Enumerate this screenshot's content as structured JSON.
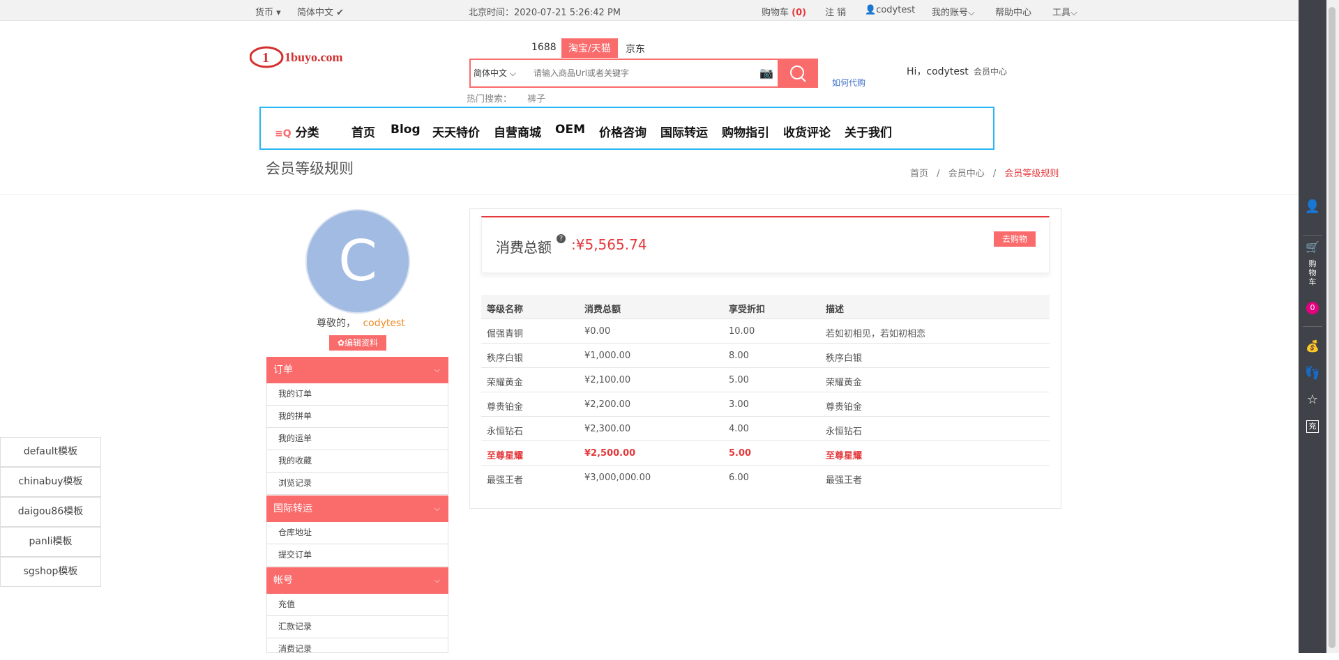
{
  "topbar": {
    "currency": "货币",
    "language": "简体中文",
    "time_label": "北京时间：",
    "time_value": "2020-07-21 5:26:42 PM",
    "cart_label": "购物车",
    "cart_count": "(0)",
    "logout": "注 销",
    "username": "codytest",
    "account": "我的账号",
    "help": "帮助中心",
    "tools": "工具"
  },
  "header": {
    "logo_text": "1buyo.com",
    "search_tabs": [
      "1688",
      "淘宝/天猫",
      "京东"
    ],
    "search_lang": "简体中文",
    "search_placeholder": "请输入商品Url或者关键字",
    "hot_label": "热门搜索：",
    "hot_keyword": "裤子",
    "how_link": "如何代购",
    "greeting": "Hi，codytest",
    "member_center": "会员中心"
  },
  "nav": {
    "category": "分类",
    "items": [
      "首页",
      "Blog",
      "天天特价",
      "自营商城",
      "OEM",
      "价格咨询",
      "国际转运",
      "购物指引",
      "收货评论",
      "关于我们"
    ]
  },
  "page": {
    "title": "会员等级规则",
    "breadcrumb": [
      "首页",
      "会员中心",
      "会员等级规则"
    ]
  },
  "profile": {
    "avatar_letter": "C",
    "greeting": "尊敬的，",
    "name": "codytest",
    "edit_button": "✿编辑资料"
  },
  "menu": [
    {
      "title": "订单",
      "items": [
        "我的订单",
        "我的拼单",
        "我的运单",
        "我的收藏",
        "浏览记录"
      ]
    },
    {
      "title": "国际转运",
      "items": [
        "仓库地址",
        "提交订单"
      ]
    },
    {
      "title": "帐号",
      "items": [
        "充值",
        "汇款记录",
        "消费记录"
      ]
    }
  ],
  "templates": [
    "default模板",
    "chinabuy模板",
    "daigou86模板",
    "panli模板",
    "sgshop模板"
  ],
  "summary": {
    "label": "消费总额",
    "value": ":¥5,565.74",
    "shop_button": "去购物"
  },
  "table": {
    "headers": [
      "等级名称",
      "消费总额",
      "享受折扣",
      "描述"
    ],
    "rows": [
      [
        "倔强青铜",
        "¥0.00",
        "10.00",
        "若如初相见，若如初相恋"
      ],
      [
        "秩序白银",
        "¥1,000.00",
        "8.00",
        "秩序白银"
      ],
      [
        "荣耀黄金",
        "¥2,100.00",
        "5.00",
        "荣耀黄金"
      ],
      [
        "尊贵铂金",
        "¥2,200.00",
        "3.00",
        "尊贵铂金"
      ],
      [
        "永恒钻石",
        "¥2,300.00",
        "4.00",
        "永恒钻石"
      ],
      [
        "至尊星耀",
        "¥2,500.00",
        "5.00",
        "至尊星耀"
      ],
      [
        "最强王者",
        "¥3,000,000.00",
        "6.00",
        "最强王者"
      ]
    ],
    "highlight_row": 5
  },
  "rightbar": {
    "cart_label": "购物车",
    "cart_count": "0",
    "recharge": "充"
  }
}
